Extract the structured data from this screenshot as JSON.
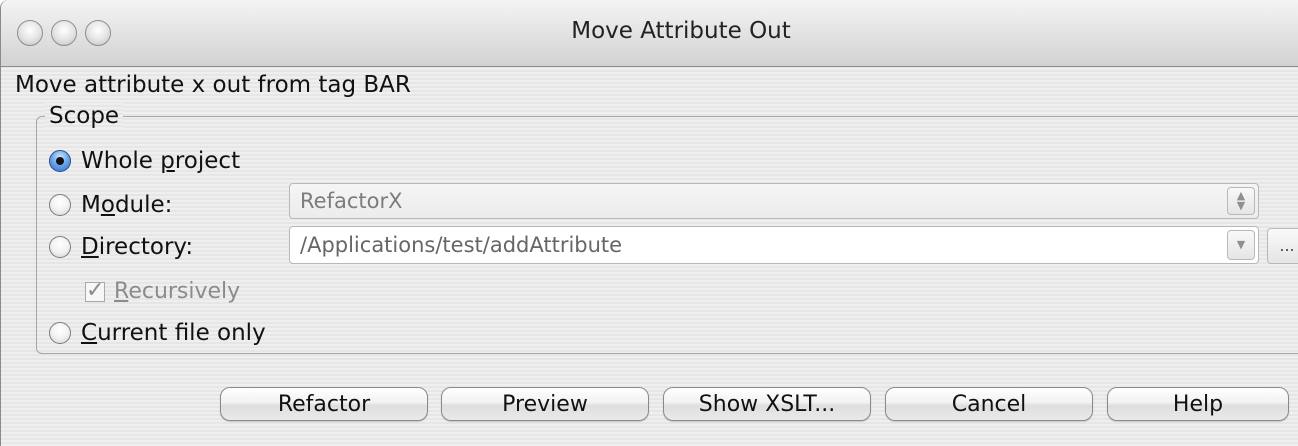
{
  "window": {
    "title": "Move Attribute Out"
  },
  "dialog": {
    "heading": "Move attribute x out from tag BAR",
    "scope_label": "Scope"
  },
  "scope_options": {
    "whole_project": {
      "prefix": "Whole ",
      "mnemonic": "p",
      "suffix": "roject",
      "checked": true
    },
    "module": {
      "prefix": "M",
      "mnemonic": "o",
      "suffix": "dule:",
      "checked": false,
      "value": "RefactorX"
    },
    "directory": {
      "prefix": "",
      "mnemonic": "D",
      "suffix": "irectory:",
      "checked": false,
      "value": "/Applications/test/addAttribute"
    },
    "recursively": {
      "mnemonic": "R",
      "suffix": "ecursively",
      "checked": true,
      "enabled": false
    },
    "current_file": {
      "prefix": "",
      "mnemonic": "C",
      "suffix": "urrent file only",
      "checked": false
    }
  },
  "buttons": {
    "refactor": "Refactor",
    "preview": "Preview",
    "show_xslt": "Show XSLT...",
    "cancel": "Cancel",
    "help": "Help"
  },
  "colors": {
    "selected_radio": "#2e6cc4",
    "disabled_text": "#8b8b8b"
  }
}
